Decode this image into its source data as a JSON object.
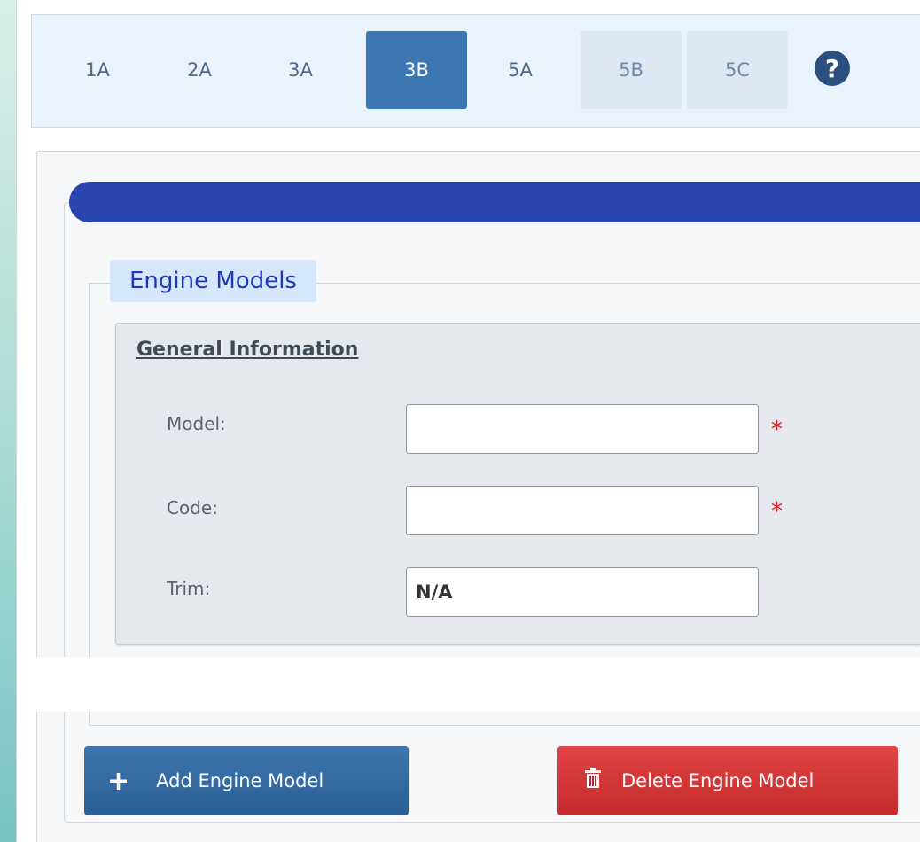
{
  "tabs": [
    {
      "label": "1A"
    },
    {
      "label": "2A"
    },
    {
      "label": "3A"
    },
    {
      "label": "3B"
    },
    {
      "label": "5A"
    },
    {
      "label": "5B"
    },
    {
      "label": "5C"
    }
  ],
  "help_icon": "question-circle-icon",
  "section_legend": "Engine Models",
  "general": {
    "title": "General Information",
    "model_label": "Model:",
    "model_value": "",
    "code_label": "Code:",
    "code_value": "",
    "trim_label": "Trim:",
    "trim_value": "N/A",
    "required_marker": "*"
  },
  "buttons": {
    "add_label": "Add Engine Model",
    "delete_label": "Delete Engine Model"
  },
  "colors": {
    "active_tab": "#3a77b3",
    "progress_bar": "#2a45b0",
    "legend_text": "#2038b8",
    "add_button": "#2f669d",
    "delete_button": "#d23636",
    "required": "#e31c1c"
  }
}
